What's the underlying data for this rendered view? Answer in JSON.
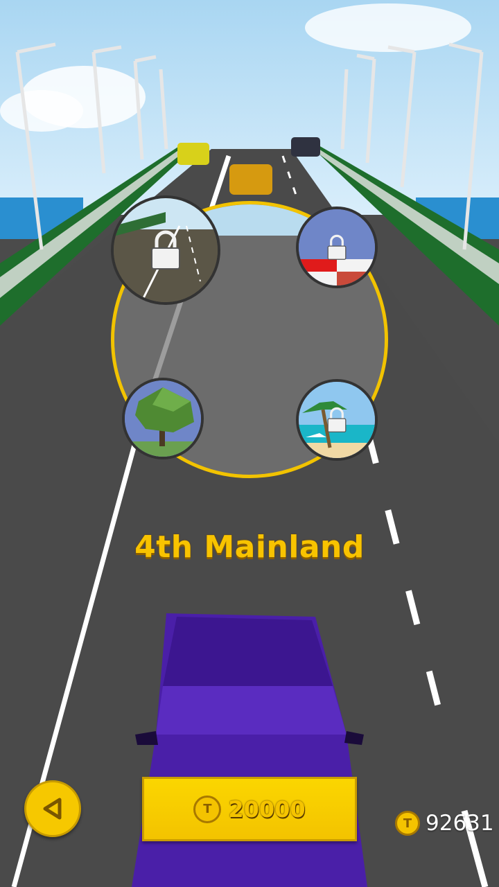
{
  "map_name": "4th Mainland",
  "buy": {
    "price": "20000",
    "coin_icon": "T"
  },
  "wallet": {
    "balance": "92631",
    "coin_icon": "T"
  },
  "colors": {
    "accent": "#f5c400",
    "road": "#4b4b4b",
    "player_car": "#4a1fa8"
  },
  "map_options": [
    {
      "id": "bridge",
      "locked": true
    },
    {
      "id": "racetrack",
      "locked": true
    },
    {
      "id": "forest",
      "locked": false
    },
    {
      "id": "beach",
      "locked": true
    }
  ]
}
